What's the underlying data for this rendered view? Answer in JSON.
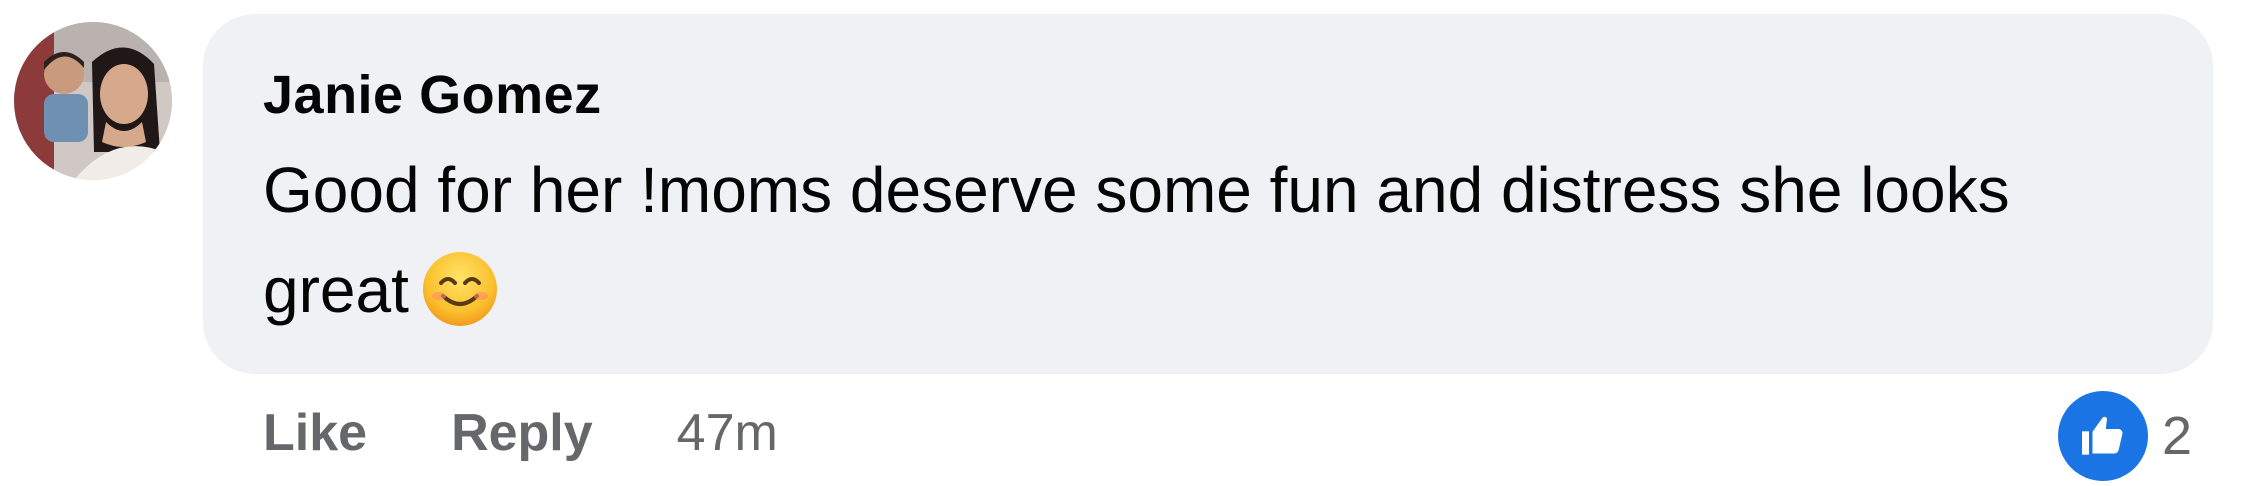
{
  "comment": {
    "author": "Janie Gomez",
    "text": "Good for her !moms deserve some fun and distress she looks great",
    "emoji": "smiling-face-emoji"
  },
  "actions": {
    "like_label": "Like",
    "reply_label": "Reply",
    "timestamp": "47m"
  },
  "reactions": {
    "icon": "thumbs-up-icon",
    "count": "2"
  },
  "colors": {
    "bubble": "#f0f1f5",
    "text": "#050505",
    "secondary": "#65676b",
    "accent": "#1b74e4"
  }
}
